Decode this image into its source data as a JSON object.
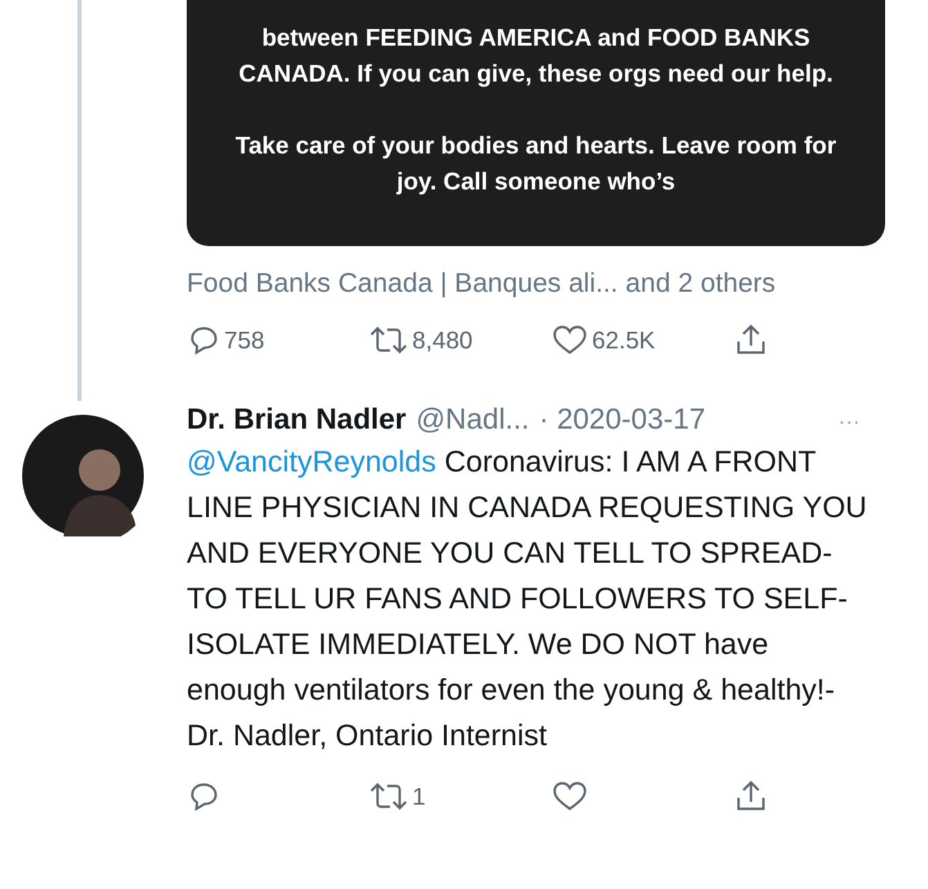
{
  "first_tweet": {
    "media_text": [
      "between FEEDING AMERICA and FOOD BANKS CANADA. If you can give, these orgs need our help.",
      "Take care of your bodies and hearts. Leave room for joy. Call someone who’s"
    ],
    "mentioned_accounts": "Food Banks Canada | Banques ali... and 2 others",
    "actions": [
      {
        "kind": "reply",
        "count": "758"
      },
      {
        "kind": "retweet",
        "count": "8,480"
      },
      {
        "kind": "like",
        "count": "62.5K"
      },
      {
        "kind": "share"
      }
    ]
  },
  "reply_tweet": {
    "name": "Dr. Brian Nadler",
    "handle": "@Nadl...",
    "date": "· 2020-03-17",
    "more": "···",
    "mention": "@VancityReynolds",
    "text": "Coronavirus: I AM A FRONT LINE PHYSICIAN IN CANADA REQUESTING YOU AND EVERYONE YOU CAN TELL TO SPREAD- TO TELL UR FANS AND FOLLOWERS TO SELF-ISOLATE IMMEDIATELY. We DO NOT have enough ventilators for even the young & healthy!- Dr. Nadler, Ontario Internist",
    "actions": [
      {
        "kind": "reply"
      },
      {
        "kind": "retweet",
        "count": "1"
      },
      {
        "kind": "like"
      },
      {
        "kind": "share"
      }
    ]
  }
}
